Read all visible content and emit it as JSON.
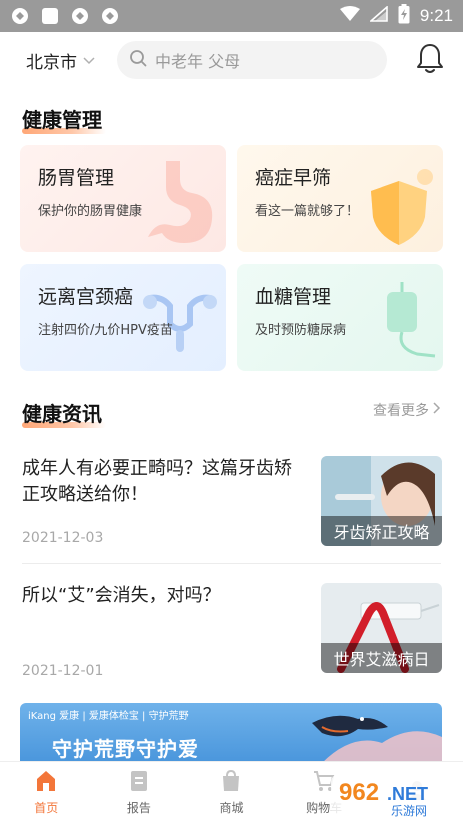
{
  "status_bar": {
    "time": "9:21"
  },
  "header": {
    "city": "北京市",
    "search_placeholder": "中老年 父母"
  },
  "health_management": {
    "title": "健康管理",
    "cards": [
      {
        "title": "肠胃管理",
        "subtitle": "保护你的肠胃健康"
      },
      {
        "title": "癌症早筛",
        "subtitle": "看这一篇就够了！"
      },
      {
        "title": "远离宫颈癌",
        "subtitle": "注射四价/九价HPV疫苗"
      },
      {
        "title": "血糖管理",
        "subtitle": "及时预防糖尿病"
      }
    ]
  },
  "health_news": {
    "title": "健康资讯",
    "more_label": "查看更多",
    "items": [
      {
        "title": "成年人有必要正畸吗？这篇牙齿矫正攻略送给你！",
        "date": "2021-12-03",
        "thumb_caption": "牙齿矫正攻略"
      },
      {
        "title": "所以“艾”会消失，对吗？",
        "date": "2021-12-01",
        "thumb_caption": "世界艾滋病日"
      }
    ]
  },
  "banner": {
    "brand": "iKang 爱康 | 爱康体检宝 | 守护荒野",
    "slogan": "守护荒野守护爱"
  },
  "tabs": [
    {
      "label": "首页",
      "active": true
    },
    {
      "label": "报告",
      "active": false
    },
    {
      "label": "商城",
      "active": false
    },
    {
      "label": "购物车",
      "active": false
    },
    {
      "label": "",
      "active": false
    }
  ],
  "watermark": "962.NET 乐游网",
  "colors": {
    "accent": "#f3763a",
    "status_bar": "#9a9a9a"
  }
}
